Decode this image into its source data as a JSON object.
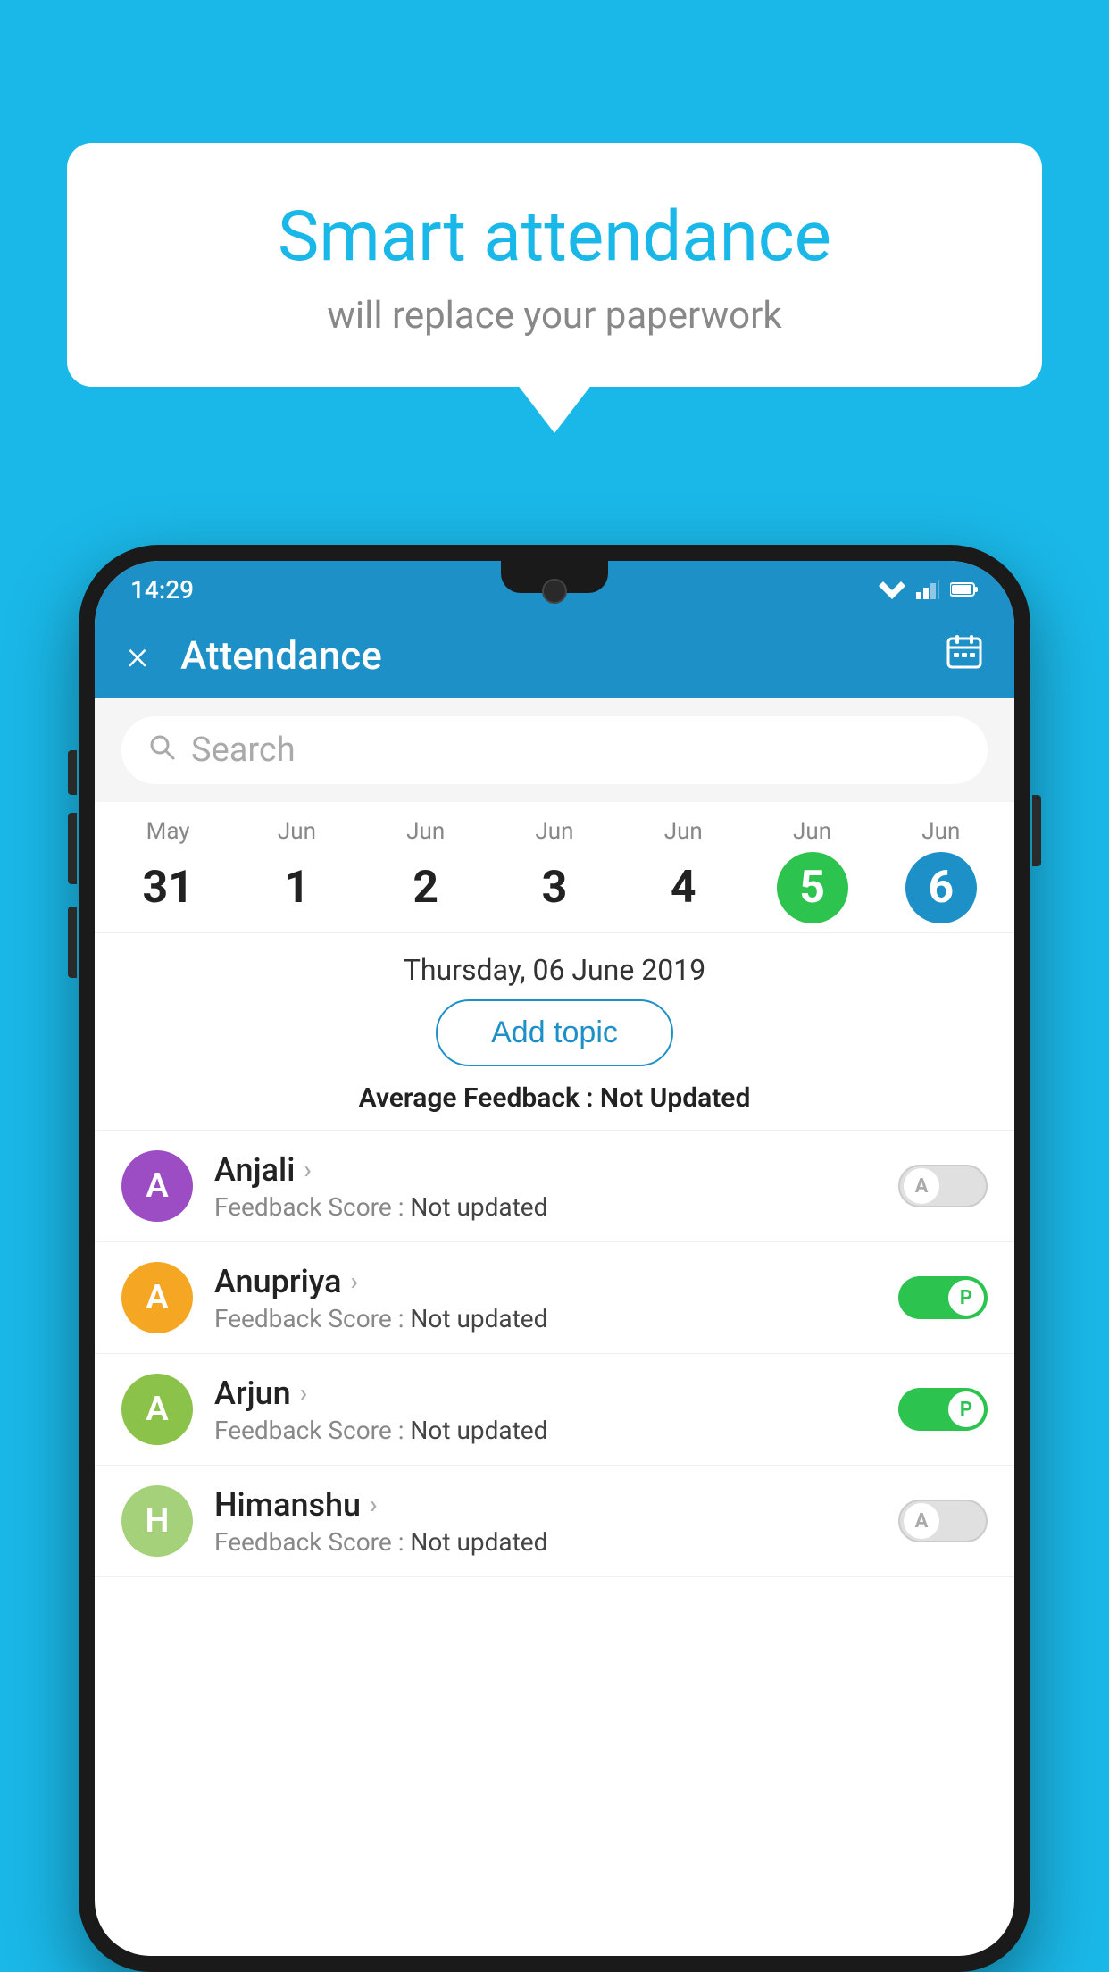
{
  "background_color": "#1ab8e8",
  "speech_bubble": {
    "title": "Smart attendance",
    "subtitle": "will replace your paperwork"
  },
  "status_bar": {
    "time": "14:29"
  },
  "app_bar": {
    "title": "Attendance",
    "close_icon": "×",
    "calendar_icon": "📅"
  },
  "search": {
    "placeholder": "Search"
  },
  "calendar": {
    "dates": [
      {
        "month": "May",
        "day": "31",
        "state": "normal"
      },
      {
        "month": "Jun",
        "day": "1",
        "state": "normal"
      },
      {
        "month": "Jun",
        "day": "2",
        "state": "normal"
      },
      {
        "month": "Jun",
        "day": "3",
        "state": "normal"
      },
      {
        "month": "Jun",
        "day": "4",
        "state": "normal"
      },
      {
        "month": "Jun",
        "day": "5",
        "state": "today"
      },
      {
        "month": "Jun",
        "day": "6",
        "state": "selected"
      }
    ]
  },
  "selected_date": "Thursday, 06 June 2019",
  "add_topic_label": "Add topic",
  "average_feedback_label": "Average Feedback :",
  "average_feedback_value": "Not Updated",
  "students": [
    {
      "name": "Anjali",
      "initial": "A",
      "avatar_color": "#9c4dc4",
      "feedback_label": "Feedback Score :",
      "feedback_value": "Not updated",
      "toggle_state": "off",
      "toggle_label": "A"
    },
    {
      "name": "Anupriya",
      "initial": "A",
      "avatar_color": "#f5a623",
      "feedback_label": "Feedback Score :",
      "feedback_value": "Not updated",
      "toggle_state": "on",
      "toggle_label": "P"
    },
    {
      "name": "Arjun",
      "initial": "A",
      "avatar_color": "#8bc34a",
      "feedback_label": "Feedback Score :",
      "feedback_value": "Not updated",
      "toggle_state": "on",
      "toggle_label": "P"
    },
    {
      "name": "Himanshu",
      "initial": "H",
      "avatar_color": "#a5d17a",
      "feedback_label": "Feedback Score :",
      "feedback_value": "Not updated",
      "toggle_state": "off",
      "toggle_label": "A"
    }
  ]
}
